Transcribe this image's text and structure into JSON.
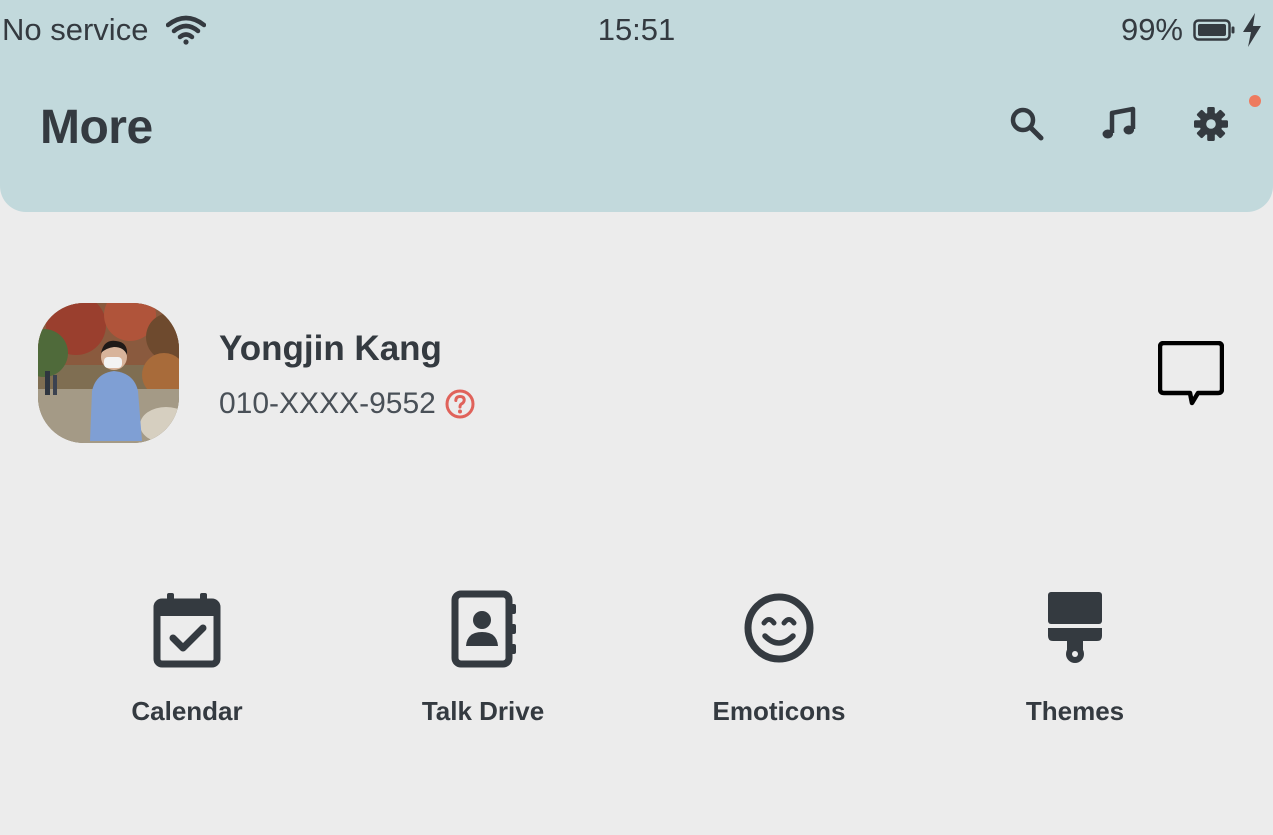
{
  "status_bar": {
    "carrier": "No service",
    "time": "15:51",
    "battery": "99%",
    "icons": [
      "wifi-icon",
      "battery-icon",
      "charging-bolt-icon"
    ]
  },
  "header": {
    "title": "More",
    "actions": [
      "search-icon",
      "music-note-icon",
      "gear-icon"
    ],
    "notification_dot_color": "#ee7b5f"
  },
  "profile": {
    "name": "Yongjin Kang",
    "phone": "010-XXXX-9552",
    "help_icon": "question-circle-icon",
    "help_icon_color": "#e0625a",
    "chat_icon": "chat-bubble-icon"
  },
  "shortcuts": [
    {
      "label": "Calendar",
      "icon": "calendar-check-icon"
    },
    {
      "label": "Talk Drive",
      "icon": "contacts-book-icon"
    },
    {
      "label": "Emoticons",
      "icon": "smiley-icon"
    },
    {
      "label": "Themes",
      "icon": "paint-brush-icon"
    }
  ],
  "colors": {
    "header_bg": "#c2d9dc",
    "page_bg": "#ececec",
    "text": "#343a40"
  }
}
